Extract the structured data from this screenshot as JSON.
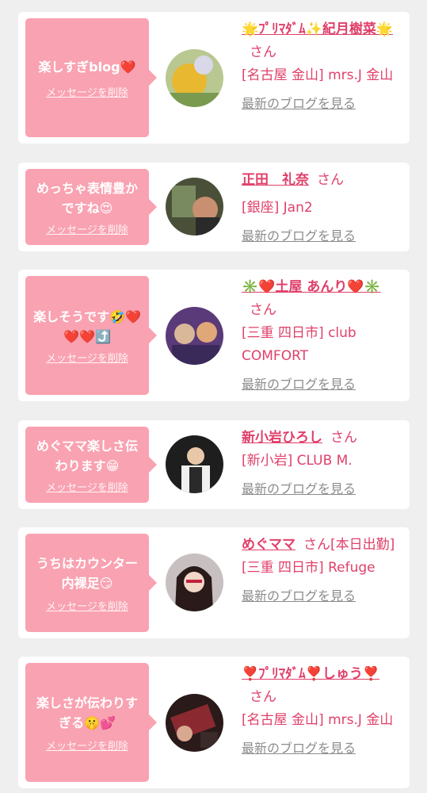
{
  "delete_label": "メッセージを削除",
  "blog_link_label": "最新のブログを見る",
  "san": "さん",
  "colors": {
    "accent": "#e0406a",
    "bubble": "#f9a2b1",
    "background": "#efefef"
  },
  "items": [
    {
      "message": "楽しすぎblog❤️",
      "name_parts": [
        "🌟",
        "ﾌﾟﾘﾏﾀﾞﾑ",
        "✨",
        "紀月樹菜",
        "🌟"
      ],
      "name": "🌟ﾌﾟﾘﾏﾀﾞﾑ✨紀月樹菜🌟",
      "suffix": "",
      "shop": "[名古屋 金山] mrs.J 金山"
    },
    {
      "message": "めっちゃ表情豊かですね😍",
      "name": "正田　礼奈",
      "suffix": "",
      "shop": "[銀座] Jan2"
    },
    {
      "message": "楽しそうです🤣❤️❤️❤️⤴️",
      "name": "✳️❤️土屋 あんり❤️✳️",
      "suffix": "",
      "shop": "[三重 四日市] club COMFORT"
    },
    {
      "message": "めぐママ楽しさ伝わります😁",
      "name": "新小岩ひろし",
      "suffix": "",
      "shop": "[新小岩] CLUB M."
    },
    {
      "message": "うちはカウンター内裸足😏",
      "name": "めぐママ",
      "suffix": "[本日出勤]",
      "shop": "[三重 四日市] Refuge"
    },
    {
      "message": "楽しさが伝わりすぎる🤫💕",
      "name": "❣️ﾌﾟﾘﾏﾀﾞﾑ❣️しゅう❣️",
      "suffix": "",
      "shop": "[名古屋 金山] mrs.J 金山"
    }
  ]
}
